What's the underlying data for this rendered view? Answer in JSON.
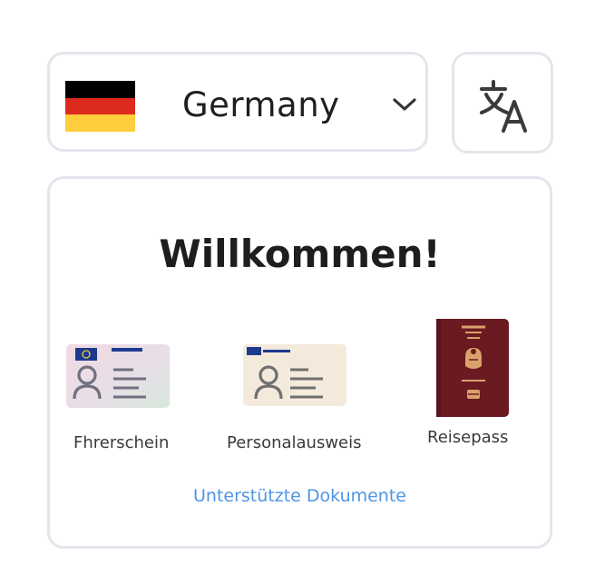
{
  "country_selector": {
    "country": "Germany",
    "flag_colors": [
      "#000000",
      "#dd2a1f",
      "#ffce3c"
    ],
    "chevron_icon": "chevron-down-icon"
  },
  "language_button": {
    "icon": "translate-icon"
  },
  "welcome": {
    "title": "Willkommen!",
    "documents": [
      {
        "label": "Fhrerschein",
        "icon": "drivers-license-icon"
      },
      {
        "label": "Personalausweis",
        "icon": "id-card-icon"
      },
      {
        "label": "Reisepass",
        "icon": "passport-icon"
      }
    ],
    "supported_link": "Unterstützte Dokumente"
  },
  "colors": {
    "border": "#e4e6ee",
    "link": "#4f95e6",
    "passport": "#6b1a22"
  }
}
